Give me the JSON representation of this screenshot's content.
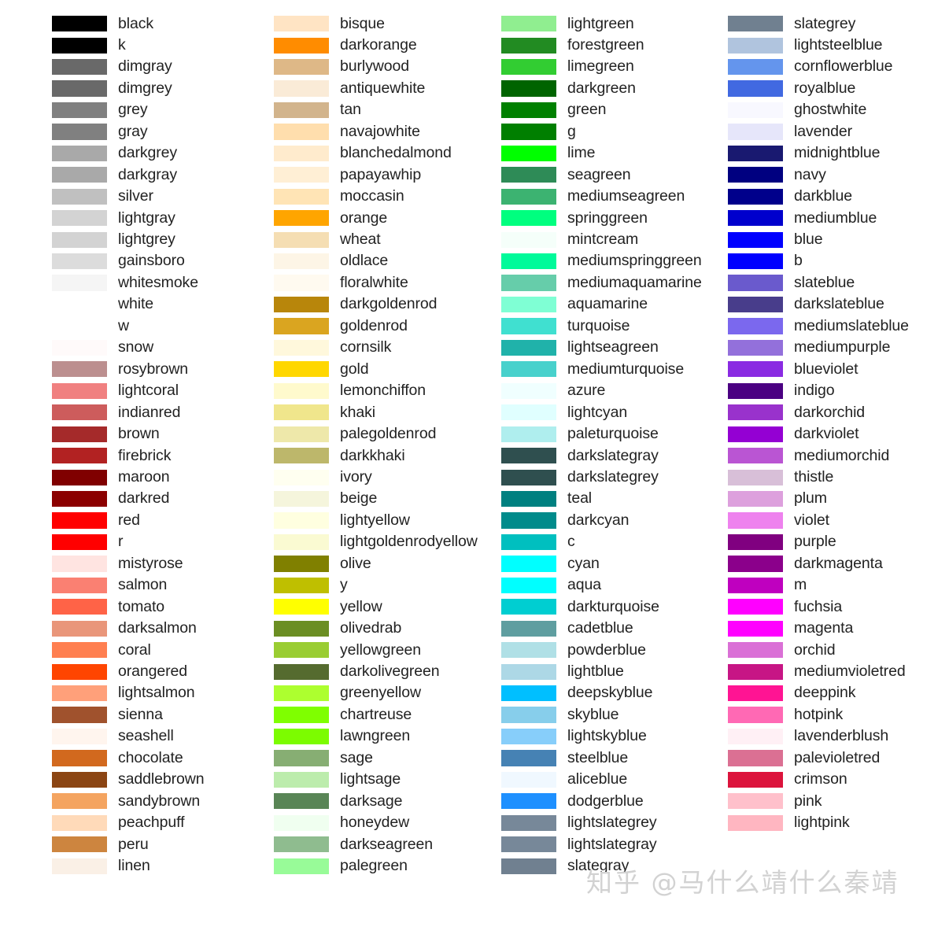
{
  "layout": {
    "row_pitch": 27.45,
    "first_row_top": 16.5,
    "column_x": [
      66,
      348,
      637,
      925
    ],
    "swatch_width": 70,
    "swatch_height": 20.2,
    "label_offset": 84
  },
  "watermark": {
    "text": "知乎 @马什么靖什么秦靖"
  },
  "chart_data": {
    "type": "table",
    "title": "Matplotlib named colors reference chart",
    "columns": 4,
    "swatch_name_key": "name",
    "swatch_color_key": "hex",
    "color_columns": [
      [
        {
          "name": "black",
          "hex": "#000000"
        },
        {
          "name": "k",
          "hex": "#000000"
        },
        {
          "name": "dimgray",
          "hex": "#696969"
        },
        {
          "name": "dimgrey",
          "hex": "#696969"
        },
        {
          "name": "grey",
          "hex": "#808080"
        },
        {
          "name": "gray",
          "hex": "#808080"
        },
        {
          "name": "darkgrey",
          "hex": "#a9a9a9"
        },
        {
          "name": "darkgray",
          "hex": "#a9a9a9"
        },
        {
          "name": "silver",
          "hex": "#c0c0c0"
        },
        {
          "name": "lightgray",
          "hex": "#d3d3d3"
        },
        {
          "name": "lightgrey",
          "hex": "#d3d3d3"
        },
        {
          "name": "gainsboro",
          "hex": "#dcdcdc"
        },
        {
          "name": "whitesmoke",
          "hex": "#f5f5f5"
        },
        {
          "name": "white",
          "hex": "#ffffff"
        },
        {
          "name": "w",
          "hex": "#ffffff"
        },
        {
          "name": "snow",
          "hex": "#fffafa"
        },
        {
          "name": "rosybrown",
          "hex": "#bc8f8f"
        },
        {
          "name": "lightcoral",
          "hex": "#f08080"
        },
        {
          "name": "indianred",
          "hex": "#cd5c5c"
        },
        {
          "name": "brown",
          "hex": "#a52a2a"
        },
        {
          "name": "firebrick",
          "hex": "#b22222"
        },
        {
          "name": "maroon",
          "hex": "#800000"
        },
        {
          "name": "darkred",
          "hex": "#8b0000"
        },
        {
          "name": "red",
          "hex": "#ff0000"
        },
        {
          "name": "r",
          "hex": "#ff0000"
        },
        {
          "name": "mistyrose",
          "hex": "#ffe4e1"
        },
        {
          "name": "salmon",
          "hex": "#fa8072"
        },
        {
          "name": "tomato",
          "hex": "#ff6347"
        },
        {
          "name": "darksalmon",
          "hex": "#e9967a"
        },
        {
          "name": "coral",
          "hex": "#ff7f50"
        },
        {
          "name": "orangered",
          "hex": "#ff4500"
        },
        {
          "name": "lightsalmon",
          "hex": "#ffa07a"
        },
        {
          "name": "sienna",
          "hex": "#a0522d"
        },
        {
          "name": "seashell",
          "hex": "#fff5ee"
        },
        {
          "name": "chocolate",
          "hex": "#d2691e"
        },
        {
          "name": "saddlebrown",
          "hex": "#8b4513"
        },
        {
          "name": "sandybrown",
          "hex": "#f4a460"
        },
        {
          "name": "peachpuff",
          "hex": "#ffdab9"
        },
        {
          "name": "peru",
          "hex": "#cd853f"
        },
        {
          "name": "linen",
          "hex": "#faf0e6"
        }
      ],
      [
        {
          "name": "bisque",
          "hex": "#ffe4c4"
        },
        {
          "name": "darkorange",
          "hex": "#ff8c00"
        },
        {
          "name": "burlywood",
          "hex": "#deb887"
        },
        {
          "name": "antiquewhite",
          "hex": "#faebd7"
        },
        {
          "name": "tan",
          "hex": "#d2b48c"
        },
        {
          "name": "navajowhite",
          "hex": "#ffdead"
        },
        {
          "name": "blanchedalmond",
          "hex": "#ffebcd"
        },
        {
          "name": "papayawhip",
          "hex": "#ffefd5"
        },
        {
          "name": "moccasin",
          "hex": "#ffe4b5"
        },
        {
          "name": "orange",
          "hex": "#ffa500"
        },
        {
          "name": "wheat",
          "hex": "#f5deb3"
        },
        {
          "name": "oldlace",
          "hex": "#fdf5e6"
        },
        {
          "name": "floralwhite",
          "hex": "#fffaf0"
        },
        {
          "name": "darkgoldenrod",
          "hex": "#b8860b"
        },
        {
          "name": "goldenrod",
          "hex": "#daa520"
        },
        {
          "name": "cornsilk",
          "hex": "#fff8dc"
        },
        {
          "name": "gold",
          "hex": "#ffd700"
        },
        {
          "name": "lemonchiffon",
          "hex": "#fffacd"
        },
        {
          "name": "khaki",
          "hex": "#f0e68c"
        },
        {
          "name": "palegoldenrod",
          "hex": "#eee8aa"
        },
        {
          "name": "darkkhaki",
          "hex": "#bdb76b"
        },
        {
          "name": "ivory",
          "hex": "#fffff0"
        },
        {
          "name": "beige",
          "hex": "#f5f5dc"
        },
        {
          "name": "lightyellow",
          "hex": "#ffffe0"
        },
        {
          "name": "lightgoldenrodyellow",
          "hex": "#fafad2"
        },
        {
          "name": "olive",
          "hex": "#808000"
        },
        {
          "name": "y",
          "hex": "#bfbf00"
        },
        {
          "name": "yellow",
          "hex": "#ffff00"
        },
        {
          "name": "olivedrab",
          "hex": "#6b8e23"
        },
        {
          "name": "yellowgreen",
          "hex": "#9acd32"
        },
        {
          "name": "darkolivegreen",
          "hex": "#556b2f"
        },
        {
          "name": "greenyellow",
          "hex": "#adff2f"
        },
        {
          "name": "chartreuse",
          "hex": "#7fff00"
        },
        {
          "name": "lawngreen",
          "hex": "#7cfc00"
        },
        {
          "name": "sage",
          "hex": "#87ae73"
        },
        {
          "name": "lightsage",
          "hex": "#bcecac"
        },
        {
          "name": "darksage",
          "hex": "#598556"
        },
        {
          "name": "honeydew",
          "hex": "#f0fff0"
        },
        {
          "name": "darkseagreen",
          "hex": "#8fbc8f"
        },
        {
          "name": "palegreen",
          "hex": "#98fb98"
        }
      ],
      [
        {
          "name": "lightgreen",
          "hex": "#90ee90"
        },
        {
          "name": "forestgreen",
          "hex": "#228b22"
        },
        {
          "name": "limegreen",
          "hex": "#32cd32"
        },
        {
          "name": "darkgreen",
          "hex": "#006400"
        },
        {
          "name": "green",
          "hex": "#008000"
        },
        {
          "name": "g",
          "hex": "#007f00"
        },
        {
          "name": "lime",
          "hex": "#00ff00"
        },
        {
          "name": "seagreen",
          "hex": "#2e8b57"
        },
        {
          "name": "mediumseagreen",
          "hex": "#3cb371"
        },
        {
          "name": "springgreen",
          "hex": "#00ff7f"
        },
        {
          "name": "mintcream",
          "hex": "#f5fffa"
        },
        {
          "name": "mediumspringgreen",
          "hex": "#00fa9a"
        },
        {
          "name": "mediumaquamarine",
          "hex": "#66cdaa"
        },
        {
          "name": "aquamarine",
          "hex": "#7fffd4"
        },
        {
          "name": "turquoise",
          "hex": "#40e0d0"
        },
        {
          "name": "lightseagreen",
          "hex": "#20b2aa"
        },
        {
          "name": "mediumturquoise",
          "hex": "#48d1cc"
        },
        {
          "name": "azure",
          "hex": "#f0ffff"
        },
        {
          "name": "lightcyan",
          "hex": "#e0ffff"
        },
        {
          "name": "paleturquoise",
          "hex": "#afeeee"
        },
        {
          "name": "darkslategray",
          "hex": "#2f4f4f"
        },
        {
          "name": "darkslategrey",
          "hex": "#2f4f4f"
        },
        {
          "name": "teal",
          "hex": "#008080"
        },
        {
          "name": "darkcyan",
          "hex": "#008b8b"
        },
        {
          "name": "c",
          "hex": "#00bfbf"
        },
        {
          "name": "cyan",
          "hex": "#00ffff"
        },
        {
          "name": "aqua",
          "hex": "#00ffff"
        },
        {
          "name": "darkturquoise",
          "hex": "#00ced1"
        },
        {
          "name": "cadetblue",
          "hex": "#5f9ea0"
        },
        {
          "name": "powderblue",
          "hex": "#b0e0e6"
        },
        {
          "name": "lightblue",
          "hex": "#add8e6"
        },
        {
          "name": "deepskyblue",
          "hex": "#00bfff"
        },
        {
          "name": "skyblue",
          "hex": "#87ceeb"
        },
        {
          "name": "lightskyblue",
          "hex": "#87cefa"
        },
        {
          "name": "steelblue",
          "hex": "#4682b4"
        },
        {
          "name": "aliceblue",
          "hex": "#f0f8ff"
        },
        {
          "name": "dodgerblue",
          "hex": "#1e90ff"
        },
        {
          "name": "lightslategrey",
          "hex": "#778899"
        },
        {
          "name": "lightslategray",
          "hex": "#778899"
        },
        {
          "name": "slategray",
          "hex": "#708090"
        }
      ],
      [
        {
          "name": "slategrey",
          "hex": "#708090"
        },
        {
          "name": "lightsteelblue",
          "hex": "#b0c4de"
        },
        {
          "name": "cornflowerblue",
          "hex": "#6495ed"
        },
        {
          "name": "royalblue",
          "hex": "#4169e1"
        },
        {
          "name": "ghostwhite",
          "hex": "#f8f8ff"
        },
        {
          "name": "lavender",
          "hex": "#e6e6fa"
        },
        {
          "name": "midnightblue",
          "hex": "#191970"
        },
        {
          "name": "navy",
          "hex": "#000080"
        },
        {
          "name": "darkblue",
          "hex": "#00008b"
        },
        {
          "name": "mediumblue",
          "hex": "#0000cd"
        },
        {
          "name": "blue",
          "hex": "#0000ff"
        },
        {
          "name": "b",
          "hex": "#0000ff"
        },
        {
          "name": "slateblue",
          "hex": "#6a5acd"
        },
        {
          "name": "darkslateblue",
          "hex": "#483d8b"
        },
        {
          "name": "mediumslateblue",
          "hex": "#7b68ee"
        },
        {
          "name": "mediumpurple",
          "hex": "#9370db"
        },
        {
          "name": "blueviolet",
          "hex": "#8a2be2"
        },
        {
          "name": "indigo",
          "hex": "#4b0082"
        },
        {
          "name": "darkorchid",
          "hex": "#9932cc"
        },
        {
          "name": "darkviolet",
          "hex": "#9400d3"
        },
        {
          "name": "mediumorchid",
          "hex": "#ba55d3"
        },
        {
          "name": "thistle",
          "hex": "#d8bfd8"
        },
        {
          "name": "plum",
          "hex": "#dda0dd"
        },
        {
          "name": "violet",
          "hex": "#ee82ee"
        },
        {
          "name": "purple",
          "hex": "#800080"
        },
        {
          "name": "darkmagenta",
          "hex": "#8b008b"
        },
        {
          "name": "m",
          "hex": "#bf00bf"
        },
        {
          "name": "fuchsia",
          "hex": "#ff00ff"
        },
        {
          "name": "magenta",
          "hex": "#ff00ff"
        },
        {
          "name": "orchid",
          "hex": "#da70d6"
        },
        {
          "name": "mediumvioletred",
          "hex": "#c71585"
        },
        {
          "name": "deeppink",
          "hex": "#ff1493"
        },
        {
          "name": "hotpink",
          "hex": "#ff69b4"
        },
        {
          "name": "lavenderblush",
          "hex": "#fff0f5"
        },
        {
          "name": "palevioletred",
          "hex": "#db7093"
        },
        {
          "name": "crimson",
          "hex": "#dc143c"
        },
        {
          "name": "pink",
          "hex": "#ffc0cb"
        },
        {
          "name": "lightpink",
          "hex": "#ffb6c1"
        }
      ]
    ]
  }
}
